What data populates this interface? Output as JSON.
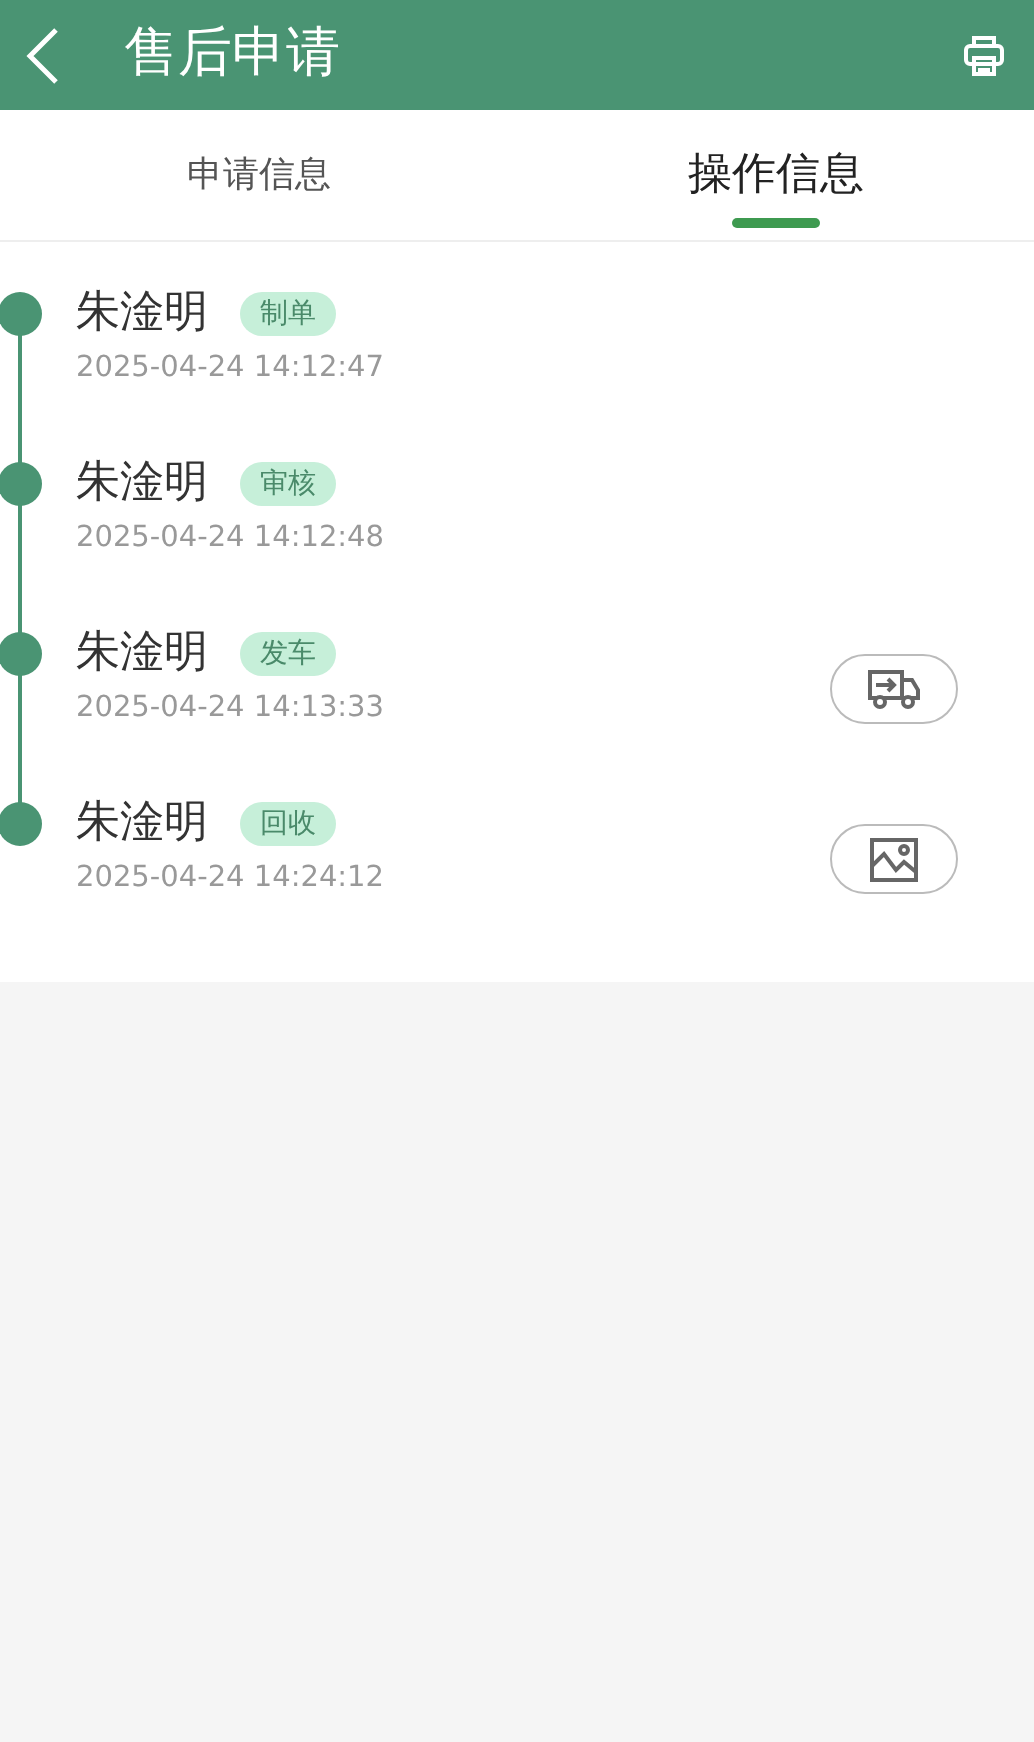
{
  "header": {
    "title": "售后申请"
  },
  "tabs": [
    {
      "label": "申请信息",
      "selected": false
    },
    {
      "label": "操作信息",
      "selected": true
    }
  ],
  "timeline": [
    {
      "name": "朱淦明",
      "tag": "制单",
      "time": "2025-04-24 14:12:47"
    },
    {
      "name": "朱淦明",
      "tag": "审核",
      "time": "2025-04-24 14:12:48"
    },
    {
      "name": "朱淦明",
      "tag": "发车",
      "time": "2025-04-24 14:13:33",
      "action": {
        "kind": "truck"
      }
    },
    {
      "name": "朱淦明",
      "tag": "回收",
      "time": "2025-04-24 14:24:12"
    }
  ]
}
